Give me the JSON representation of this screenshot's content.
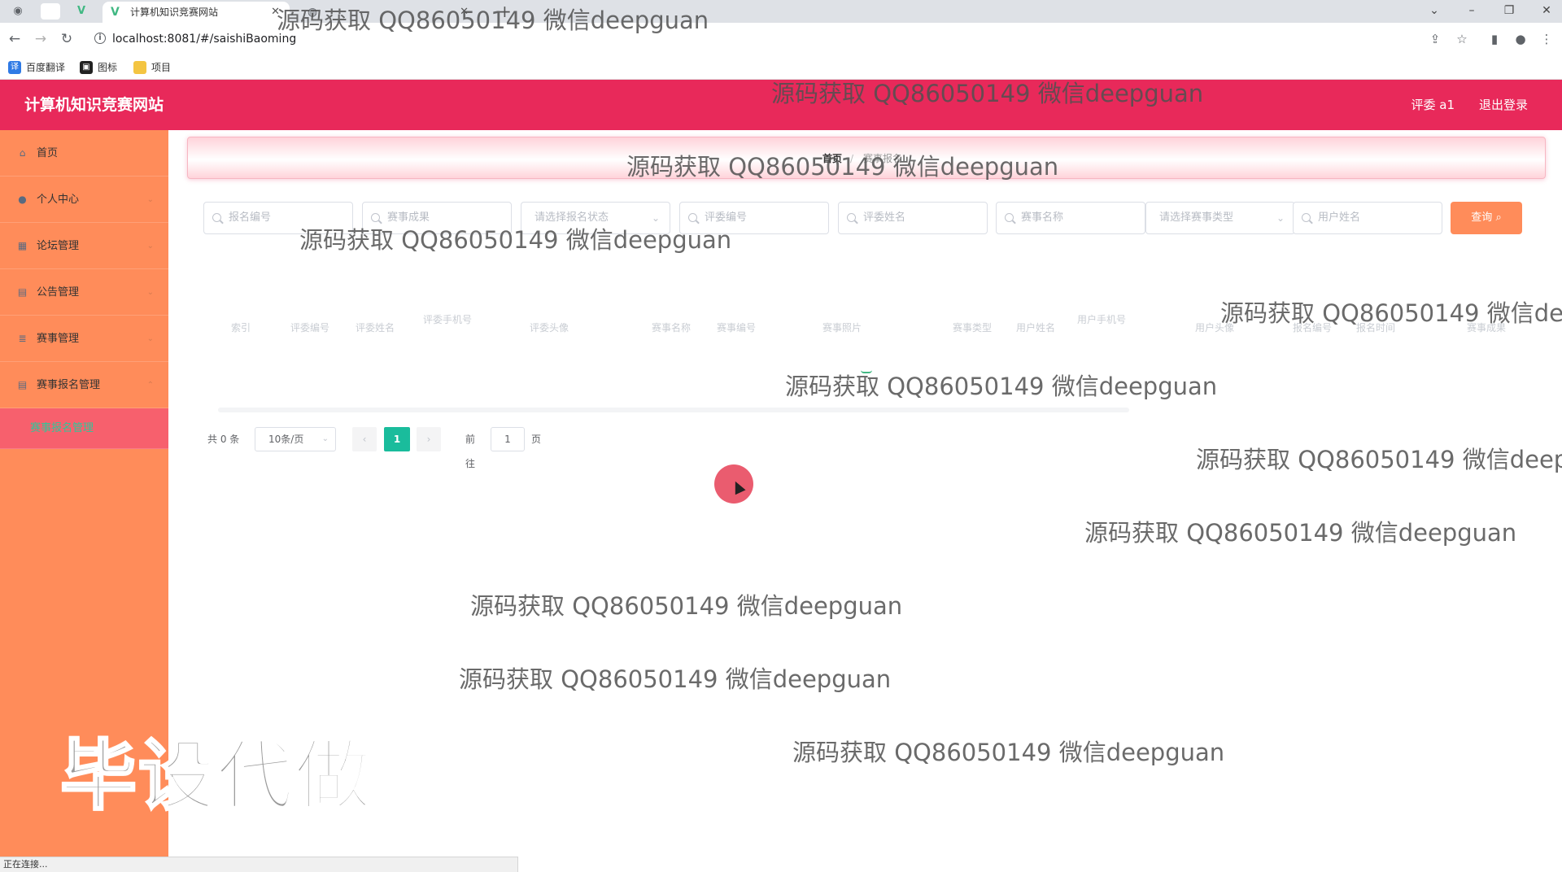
{
  "browser": {
    "active_tab_title": "计算机知识竞赛网站",
    "second_tab_title": "",
    "url": "localhost:8081/#/saishiBaoming",
    "bookmarks": [
      "百度翻译",
      "图标",
      "项目"
    ],
    "status_text": "正在连接..."
  },
  "header": {
    "app_title": "计算机知识竞赛网站",
    "user_label": "评委 a1",
    "logout_label": "退出登录",
    "accent_color": "#e8295a"
  },
  "sidebar": {
    "background_color": "#ff8c5a",
    "items": [
      {
        "label": "首页",
        "icon": "home-icon",
        "expandable": false
      },
      {
        "label": "个人中心",
        "icon": "user-icon",
        "expandable": true
      },
      {
        "label": "论坛管理",
        "icon": "grid-icon",
        "expandable": true
      },
      {
        "label": "公告管理",
        "icon": "clipboard-icon",
        "expandable": true
      },
      {
        "label": "赛事管理",
        "icon": "stack-icon",
        "expandable": true
      },
      {
        "label": "赛事报名管理",
        "icon": "clipboard-icon",
        "expandable": true,
        "expanded": true
      }
    ],
    "sub_item": "赛事报名管理"
  },
  "breadcrumb": {
    "home": "首页",
    "separator": "/",
    "current": "赛事报名"
  },
  "search": {
    "fields": [
      {
        "placeholder": "报名编号",
        "type": "input"
      },
      {
        "placeholder": "赛事成果",
        "type": "input"
      },
      {
        "placeholder": "请选择报名状态",
        "type": "select"
      },
      {
        "placeholder": "评委编号",
        "type": "input"
      },
      {
        "placeholder": "评委姓名",
        "type": "input"
      },
      {
        "placeholder": "赛事名称",
        "type": "input"
      },
      {
        "placeholder": "请选择赛事类型",
        "type": "select"
      },
      {
        "placeholder": "用户姓名",
        "type": "input"
      }
    ],
    "query_label": "查询"
  },
  "table": {
    "columns": [
      "索引",
      "评委编号",
      "评委姓名",
      "评委手机号",
      "评委头像",
      "赛事名称",
      "赛事编号",
      "赛事照片",
      "赛事类型",
      "用户姓名",
      "用户手机号",
      "用户头像",
      "报名编号",
      "报名时间",
      "赛事成果"
    ],
    "rows": []
  },
  "pagination": {
    "total_text": "共 0 条",
    "page_size": "10条/页",
    "current_page": "1",
    "goto_label": "前往",
    "goto_value": "1",
    "page_suffix": "页",
    "accent_color": "#1abc9c"
  },
  "watermarks": {
    "text": "源码获取 QQ86050149 微信deepguan",
    "big_text": "毕设代做"
  }
}
